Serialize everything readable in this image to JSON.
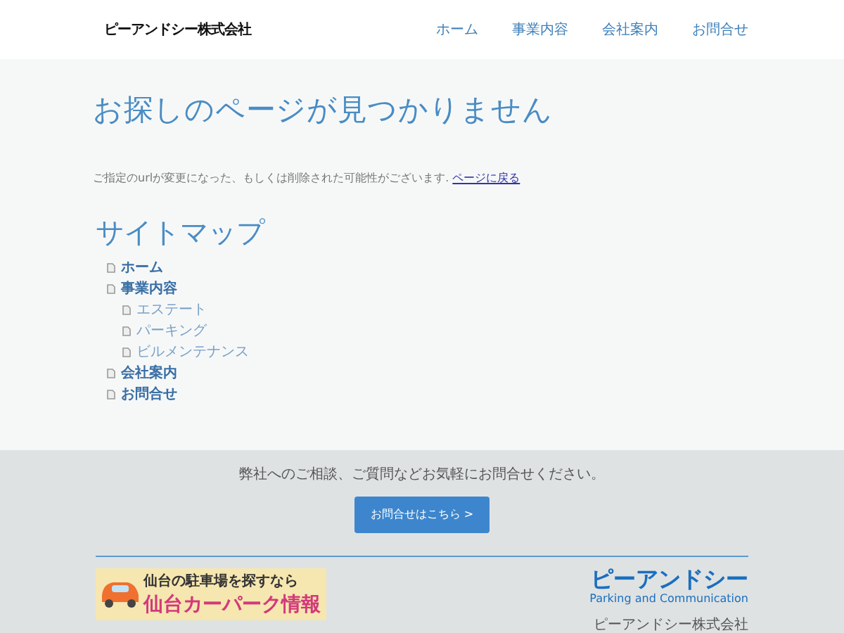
{
  "header": {
    "logo": "ピーアンドシー株式会社",
    "nav": [
      {
        "label": "ホーム"
      },
      {
        "label": "事業内容"
      },
      {
        "label": "会社案内"
      },
      {
        "label": "お問合せ"
      }
    ]
  },
  "main": {
    "title": "お探しのページが見つかりません",
    "message": "ご指定のurlが変更になった、もしくは削除された可能性がございます.",
    "back_link": "ページに戻る"
  },
  "sitemap": {
    "title": "サイトマップ",
    "items": [
      {
        "label": "ホーム"
      },
      {
        "label": "事業内容",
        "children": [
          {
            "label": "エステート"
          },
          {
            "label": "パーキング"
          },
          {
            "label": "ビルメンテナンス"
          }
        ]
      },
      {
        "label": "会社案内"
      },
      {
        "label": "お問合せ"
      }
    ]
  },
  "footer": {
    "message": "弊社へのご相談、ご質問などお気軽にお問合せください。",
    "button": "お問合せはこちら >",
    "banner": {
      "tagline": "仙台の駐車場を探すなら",
      "title": "仙台カーパーク情報"
    },
    "logo": {
      "name": "ピーアンドシー",
      "subtitle": "Parking and Communication"
    },
    "company": "ピーアンドシー株式会社"
  }
}
